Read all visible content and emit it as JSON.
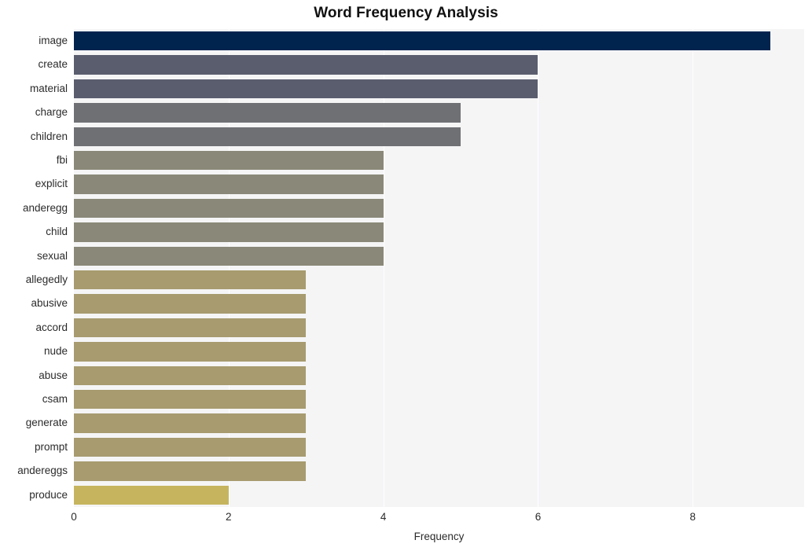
{
  "chart_data": {
    "type": "bar",
    "orientation": "horizontal",
    "title": "Word Frequency Analysis",
    "xlabel": "Frequency",
    "ylabel": "",
    "xlim": [
      0,
      9.44
    ],
    "xticks": [
      0,
      2,
      4,
      6,
      8
    ],
    "grid": true,
    "grid_axis": "x",
    "legend": "none",
    "categories": [
      "image",
      "create",
      "material",
      "charge",
      "children",
      "fbi",
      "explicit",
      "anderegg",
      "child",
      "sexual",
      "allegedly",
      "abusive",
      "accord",
      "nude",
      "abuse",
      "csam",
      "generate",
      "prompt",
      "andereggs",
      "produce"
    ],
    "values": [
      9,
      6,
      6,
      5,
      5,
      4,
      4,
      4,
      4,
      4,
      3,
      3,
      3,
      3,
      3,
      3,
      3,
      3,
      3,
      2
    ],
    "colors": [
      "#01244f",
      "#5a5d6e",
      "#5a5d6e",
      "#6f7074",
      "#6f7074",
      "#8a8878",
      "#8a8878",
      "#8a8878",
      "#8a8878",
      "#8a8878",
      "#a79b6f",
      "#a79b6f",
      "#a79b6f",
      "#a79b6f",
      "#a79b6f",
      "#a79b6f",
      "#a79b6f",
      "#a79b6f",
      "#a79b6f",
      "#c6b55e"
    ],
    "plot_background": "#f5f5f6",
    "gridline_color": "#ffffff",
    "figure_background": "#ffffff"
  }
}
